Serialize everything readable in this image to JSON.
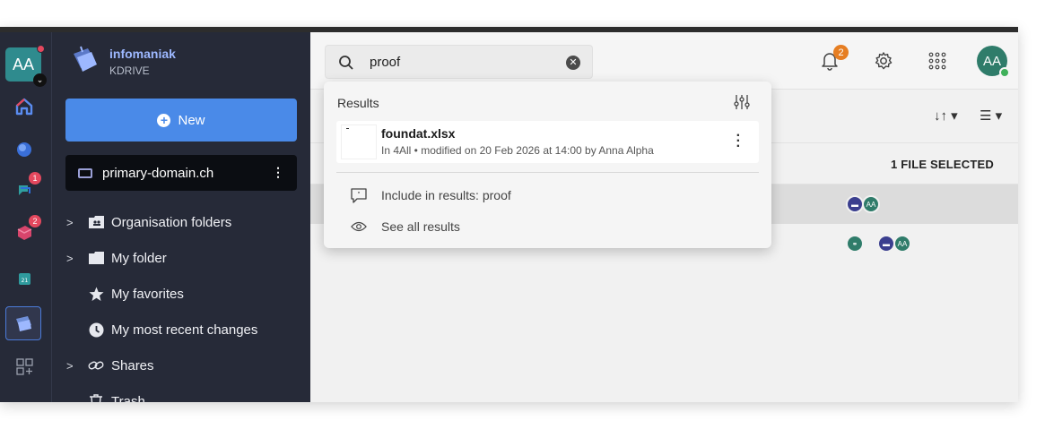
{
  "rail": {
    "avatar_initials": "AA",
    "badges": {
      "item3": "1",
      "item4": "2"
    }
  },
  "sidebar": {
    "brand_name": "infomaniak",
    "brand_sub": "KDRIVE",
    "new_label": "New",
    "drive_name": "primary-domain.ch",
    "nav": [
      {
        "label": "Organisation folders",
        "icon": "organisation-folder-icon"
      },
      {
        "label": "My folder",
        "icon": "folder-icon"
      },
      {
        "label": "My favorites",
        "icon": "star-icon"
      },
      {
        "label": "My most recent changes",
        "icon": "clock-icon"
      },
      {
        "label": "Shares",
        "icon": "link-icon"
      },
      {
        "label": "Trash",
        "icon": "trash-icon"
      }
    ]
  },
  "header": {
    "search_value": "proof",
    "notification_count": "2",
    "user_initials": "AA"
  },
  "toolbar": {
    "selection_label": "1 FILE SELECTED"
  },
  "files": {
    "row_avatar_initials": "AA"
  },
  "dropdown": {
    "title": "Results",
    "result": {
      "name": "foundat.xlsx",
      "meta": "In 4All • modified on 20 Feb 2026 at 14:00 by Anna Alpha"
    },
    "include_label": "Include in results: proof",
    "see_all_label": "See all results"
  },
  "colors": {
    "sidebar_bg": "#262a38",
    "accent": "#4a8ae8",
    "notification": "#e67e22",
    "badge": "#e4485e"
  }
}
